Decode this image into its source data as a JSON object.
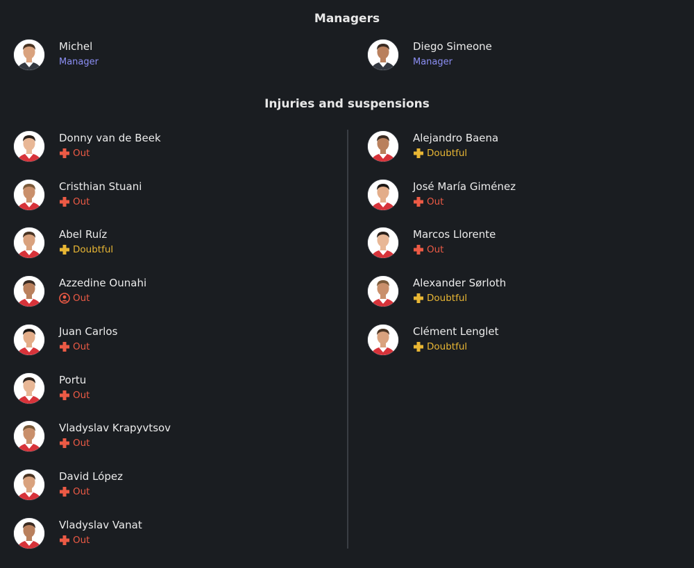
{
  "managers_title": "Managers",
  "managers": [
    {
      "name": "Michel",
      "role": "Manager"
    },
    {
      "name": "Diego Simeone",
      "role": "Manager"
    }
  ],
  "injuries_title": "Injuries and suspensions",
  "home_players": [
    {
      "name": "Donny van de Beek",
      "status": "Out",
      "icon": "injury-cross-icon"
    },
    {
      "name": "Cristhian Stuani",
      "status": "Out",
      "icon": "injury-cross-icon"
    },
    {
      "name": "Abel Ruíz",
      "status": "Doubtful",
      "icon": "injury-cross-icon"
    },
    {
      "name": "Azzedine Ounahi",
      "status": "Out",
      "icon": "person-absent-icon"
    },
    {
      "name": "Juan Carlos",
      "status": "Out",
      "icon": "injury-cross-icon"
    },
    {
      "name": "Portu",
      "status": "Out",
      "icon": "injury-cross-icon"
    },
    {
      "name": "Vladyslav Krapyvtsov",
      "status": "Out",
      "icon": "injury-cross-icon"
    },
    {
      "name": "David López",
      "status": "Out",
      "icon": "injury-cross-icon"
    },
    {
      "name": "Vladyslav Vanat",
      "status": "Out",
      "icon": "injury-cross-icon"
    }
  ],
  "away_players": [
    {
      "name": "Alejandro Baena",
      "status": "Doubtful",
      "icon": "injury-cross-icon"
    },
    {
      "name": "José María Giménez",
      "status": "Out",
      "icon": "injury-cross-icon"
    },
    {
      "name": "Marcos Llorente",
      "status": "Out",
      "icon": "injury-cross-icon"
    },
    {
      "name": "Alexander Sørloth",
      "status": "Doubtful",
      "icon": "injury-cross-icon"
    },
    {
      "name": "Clément Lenglet",
      "status": "Doubtful",
      "icon": "injury-cross-icon"
    }
  ],
  "colors": {
    "background": "#1a1d21",
    "manager_role": "#8c8ff5",
    "out": "#ec5a45",
    "doubtful": "#e8b634",
    "divider": "#3a3e44"
  }
}
